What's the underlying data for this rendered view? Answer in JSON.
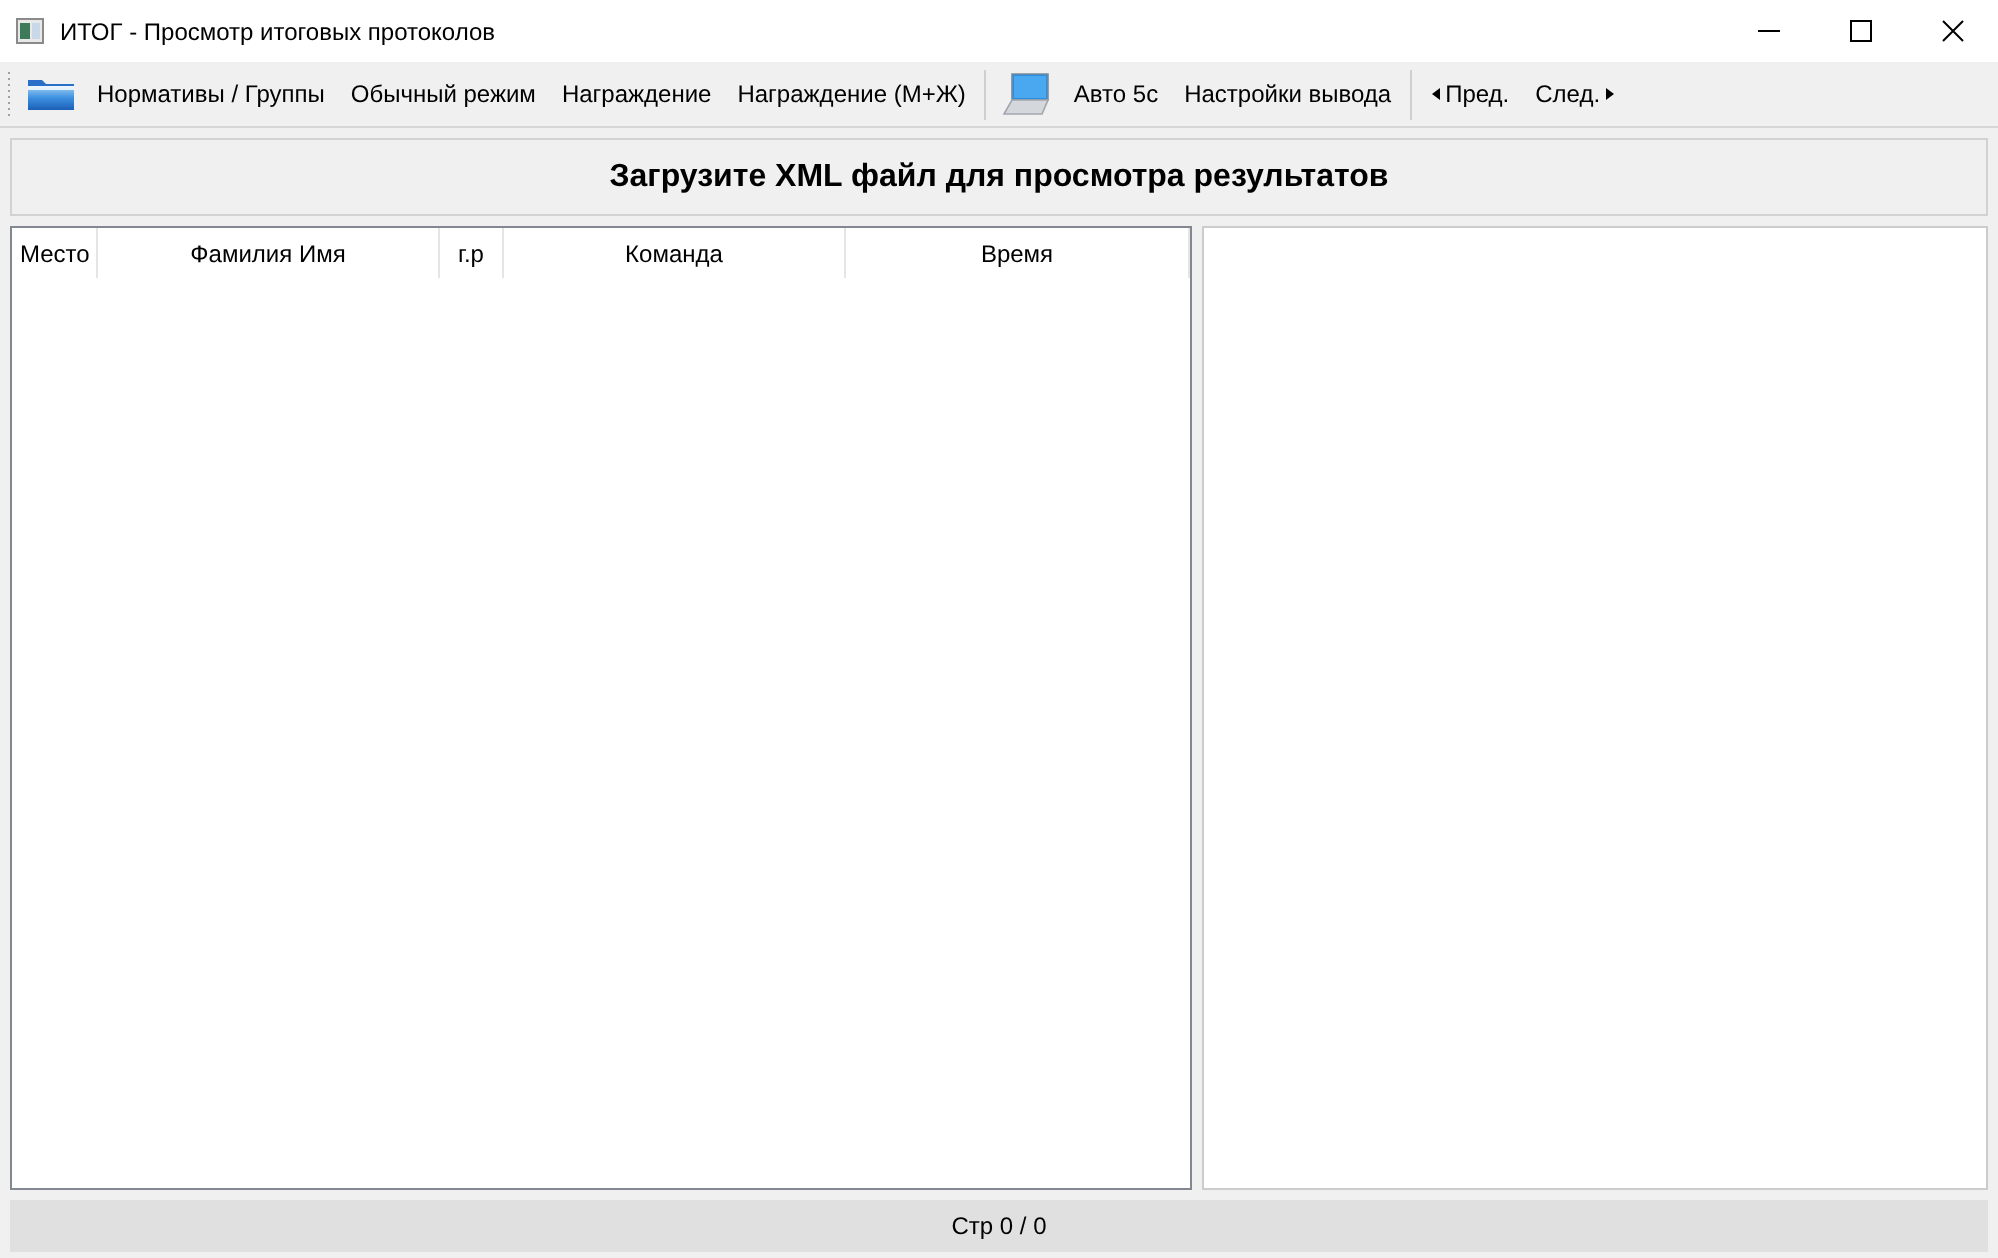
{
  "window": {
    "title": "ИТОГ - Просмотр итоговых протоколов"
  },
  "toolbar": {
    "groups": [
      {
        "items": [
          {
            "kind": "icon"
          },
          {
            "kind": "text",
            "label": "Нормативы / Группы"
          },
          {
            "kind": "text",
            "label": "Обычный режим"
          },
          {
            "kind": "text",
            "label": "Награждение"
          },
          {
            "kind": "text",
            "label": "Награждение (М+Ж)"
          }
        ]
      },
      {
        "items": [
          {
            "kind": "icon"
          },
          {
            "kind": "text",
            "label": "Авто 5с"
          },
          {
            "kind": "text",
            "label": "Настройки вывода"
          }
        ]
      },
      {
        "items": [
          {
            "kind": "prev",
            "label": "Пред."
          },
          {
            "kind": "next",
            "label": "След."
          }
        ]
      }
    ]
  },
  "banner": {
    "text": "Загрузите XML файл для просмотра результатов"
  },
  "table": {
    "columns": [
      "Место",
      "Фамилия Имя",
      "г.р",
      "Команда",
      "Время"
    ]
  },
  "status_bar": {
    "text": "Стр 0 / 0"
  }
}
